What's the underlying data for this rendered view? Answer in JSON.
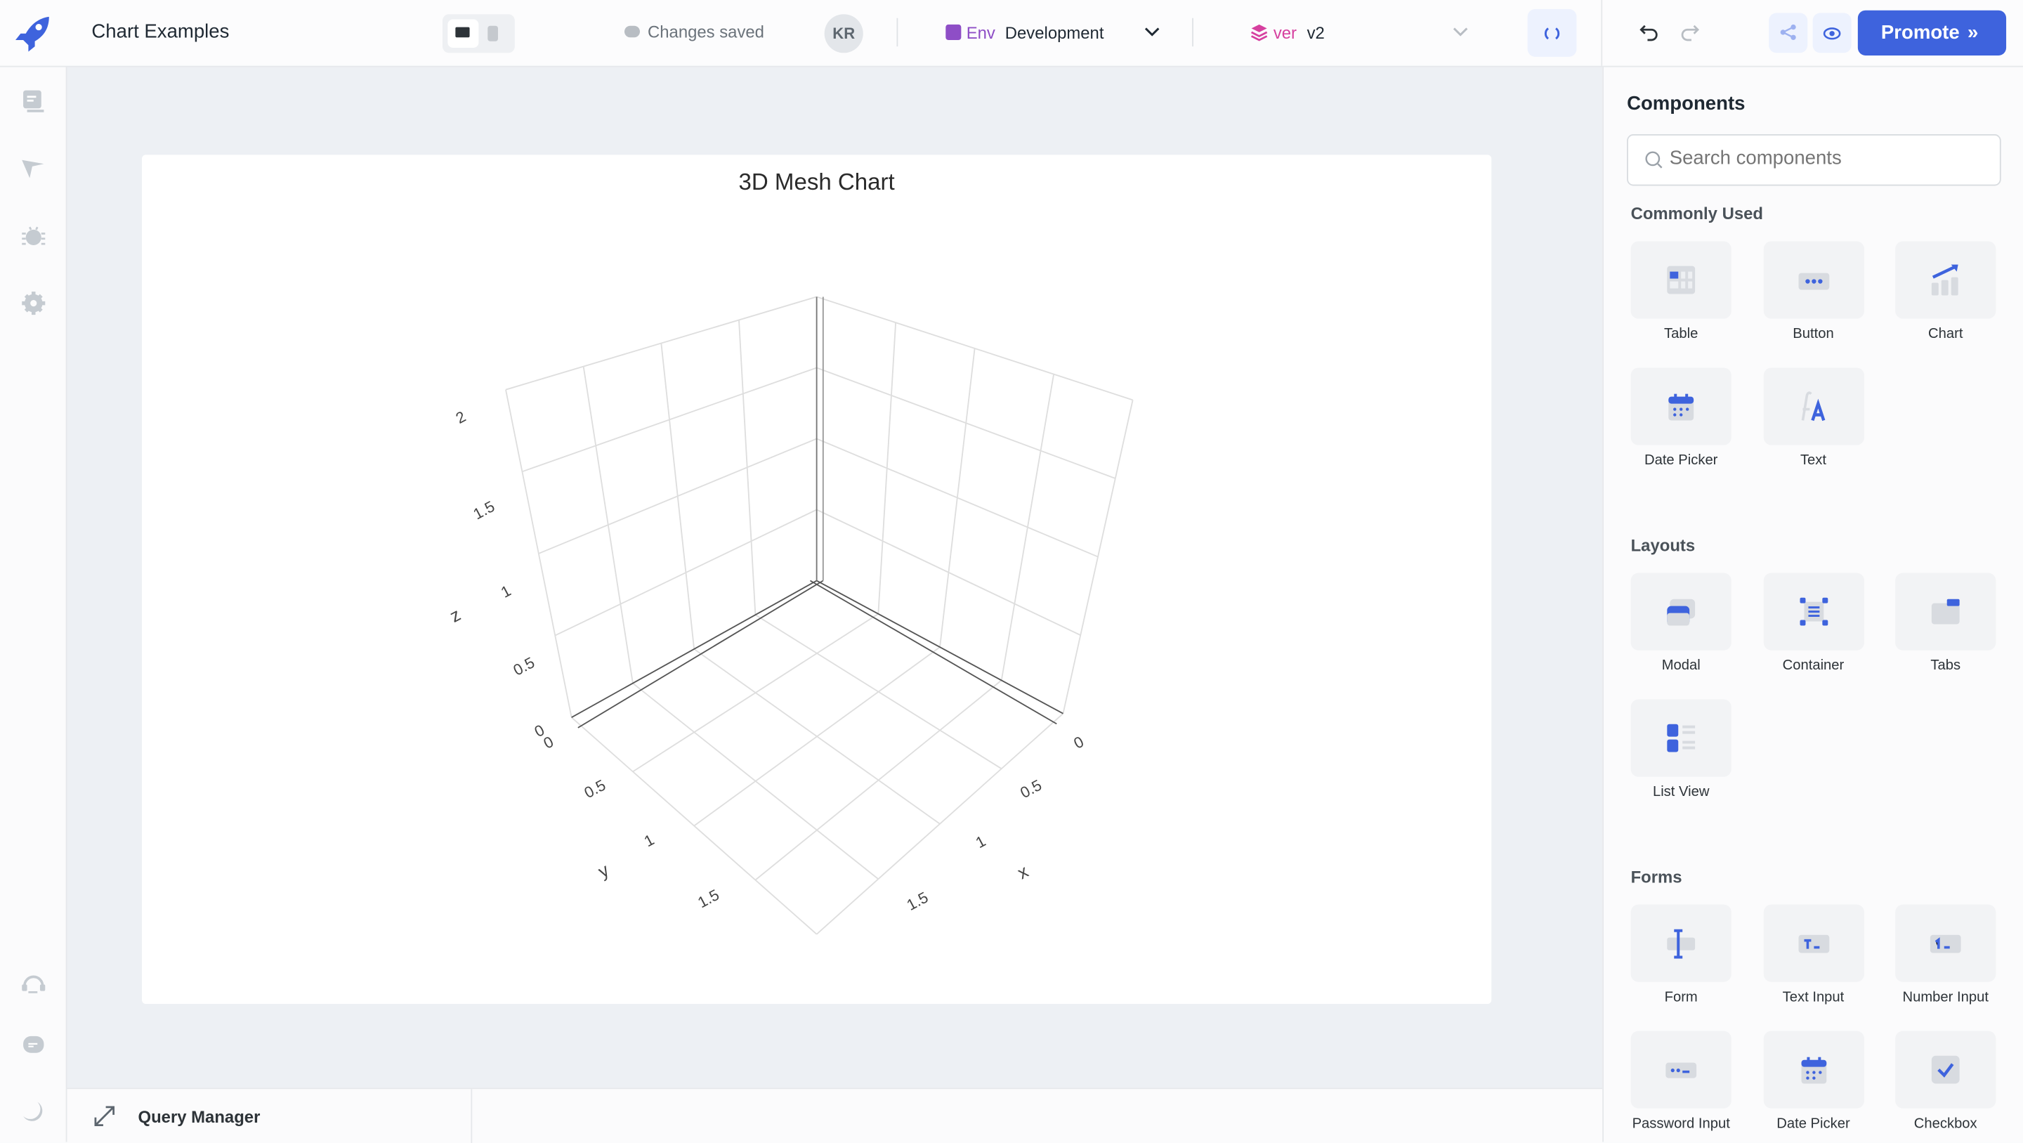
{
  "app": {
    "title": "Chart Examples"
  },
  "topbar": {
    "save_status": "Changes saved",
    "avatar_initials": "KR",
    "env_label": "Env",
    "env_value": "Development",
    "version_label": "ver",
    "version_value": "v2",
    "promote_label": "Promote",
    "promote_chevron": "»"
  },
  "colors": {
    "accent": "#3e63dd",
    "env": "#8e4ec6",
    "version": "#d6409f",
    "canvas": "#edf0f4"
  },
  "chart_data": {
    "type": "mesh3d",
    "title": "3D Mesh Chart",
    "xlabel": "x",
    "ylabel": "y",
    "zlabel": "z",
    "xlim": [
      0,
      2
    ],
    "ylim": [
      0,
      2
    ],
    "zlim": [
      0,
      2
    ],
    "x_ticks": [
      "0",
      "0.5",
      "1",
      "1.5"
    ],
    "y_ticks": [
      "0",
      "0.5",
      "1",
      "1.5"
    ],
    "z_ticks": [
      "0",
      "0.5",
      "1",
      "1.5",
      "2"
    ],
    "grid": true,
    "series": []
  },
  "panel": {
    "title": "Components",
    "search_placeholder": "Search components",
    "sections": [
      {
        "title": "Commonly Used",
        "items": [
          {
            "label": "Table",
            "icon": "table"
          },
          {
            "label": "Button",
            "icon": "button"
          },
          {
            "label": "Chart",
            "icon": "chart"
          },
          {
            "label": "Date Picker",
            "icon": "calendar"
          },
          {
            "label": "Text",
            "icon": "text"
          }
        ]
      },
      {
        "title": "Layouts",
        "items": [
          {
            "label": "Modal",
            "icon": "modal"
          },
          {
            "label": "Container",
            "icon": "container"
          },
          {
            "label": "Tabs",
            "icon": "tabs"
          },
          {
            "label": "List View",
            "icon": "listview"
          }
        ]
      },
      {
        "title": "Forms",
        "items": [
          {
            "label": "Form",
            "icon": "form"
          },
          {
            "label": "Text Input",
            "icon": "textinput"
          },
          {
            "label": "Number Input",
            "icon": "numberinput"
          },
          {
            "label": "Password Input",
            "icon": "password"
          },
          {
            "label": "Date Picker",
            "icon": "calendar"
          },
          {
            "label": "Checkbox",
            "icon": "checkbox"
          }
        ]
      }
    ]
  },
  "bottom": {
    "query_manager": "Query Manager"
  }
}
